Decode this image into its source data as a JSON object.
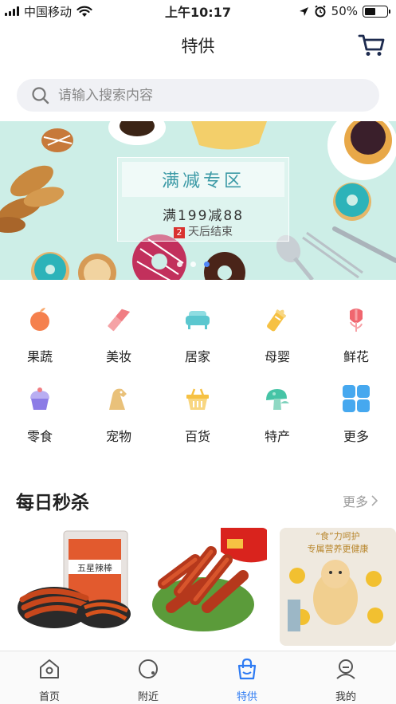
{
  "status_bar": {
    "carrier": "中国移动",
    "time": "上午10:17",
    "battery_pct": "50%",
    "battery_level": 0.5,
    "icons": [
      "signal-icon",
      "wifi-icon",
      "location-icon",
      "alarm-icon",
      "battery-icon"
    ]
  },
  "header": {
    "title": "特供",
    "cart_icon": "cart-icon"
  },
  "search": {
    "placeholder": "请输入搜索内容",
    "value": ""
  },
  "banner": {
    "heading": "满减专区",
    "offer": "满199减88",
    "days_num": "2",
    "ends_text": "天后结束",
    "page_index": 3,
    "page_count": 3,
    "bg_color": "#cdeee7"
  },
  "categories": [
    {
      "label": "果蔬",
      "icon": "fruit-icon",
      "color": "#f5804d"
    },
    {
      "label": "美妆",
      "icon": "lipstick-icon",
      "color": "#f07d83"
    },
    {
      "label": "居家",
      "icon": "sofa-icon",
      "color": "#5bc7cf"
    },
    {
      "label": "母婴",
      "icon": "baby-bottle-icon",
      "color": "#f6c143"
    },
    {
      "label": "鲜花",
      "icon": "flower-icon",
      "color": "#f0666f"
    },
    {
      "label": "零食",
      "icon": "cupcake-icon",
      "color": "#8c7ce6"
    },
    {
      "label": "宠物",
      "icon": "pet-dog-icon",
      "color": "#e9c17a"
    },
    {
      "label": "百货",
      "icon": "basket-icon",
      "color": "#f6c143"
    },
    {
      "label": "特产",
      "icon": "mushroom-icon",
      "color": "#46c4a6"
    },
    {
      "label": "更多",
      "icon": "more-grid-icon",
      "color": "#46a8ef"
    }
  ],
  "flash_sale": {
    "title": "每日秒杀",
    "more": "更多",
    "products": [
      {
        "image": "spicy-strips-product-image",
        "package_text": "五星辣棒"
      },
      {
        "image": "duck-neck-product-image"
      },
      {
        "image": "dog-food-product-image",
        "headline": "“食”力呵护",
        "subline": "专属营养更健康"
      }
    ]
  },
  "tabbar": {
    "tabs": [
      {
        "label": "首页",
        "icon": "home-icon",
        "active": false
      },
      {
        "label": "附近",
        "icon": "nearby-icon",
        "active": false
      },
      {
        "label": "特供",
        "icon": "shopping-bag-icon",
        "active": true
      },
      {
        "label": "我的",
        "icon": "profile-icon",
        "active": false
      }
    ],
    "active_color": "#2e7bf3"
  }
}
